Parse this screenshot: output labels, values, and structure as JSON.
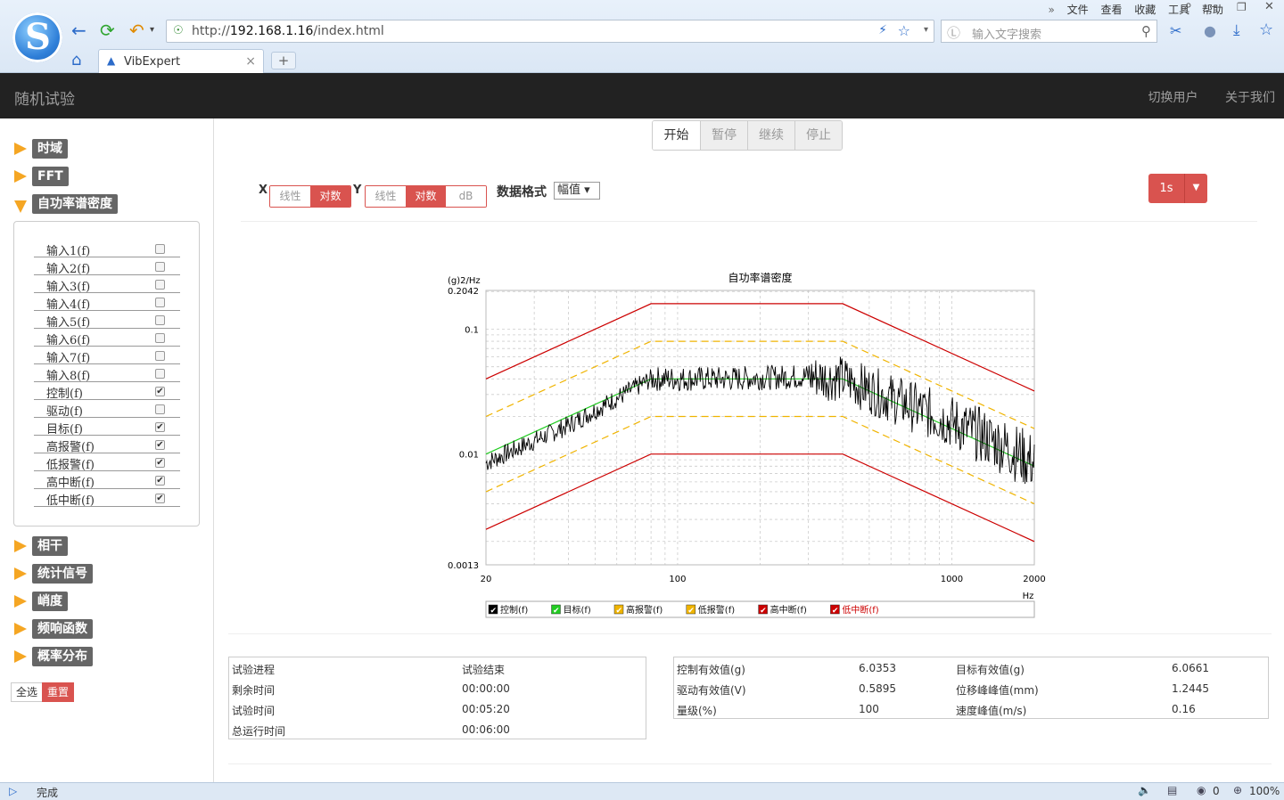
{
  "browser": {
    "url_prefix": "http://",
    "url_host": "192.168.1.16",
    "url_path": "/index.html",
    "search_placeholder": "输入文字搜索",
    "menus": [
      "文件",
      "查看",
      "收藏",
      "工具",
      "帮助"
    ],
    "tab_title": "VibExpert",
    "status_text": "完成",
    "status_count": "0",
    "zoom": "100%"
  },
  "app": {
    "title": "随机试验",
    "switch_user": "切换用户",
    "about": "关于我们"
  },
  "sidebar": {
    "sections_top": [
      "时域",
      "FFT",
      "自功率谱密度"
    ],
    "sections_bottom": [
      "相干",
      "统计信号",
      "峭度",
      "频响函数",
      "概率分布"
    ],
    "channels": [
      {
        "label": "输入1(f)",
        "checked": false
      },
      {
        "label": "输入2(f)",
        "checked": false
      },
      {
        "label": "输入3(f)",
        "checked": false
      },
      {
        "label": "输入4(f)",
        "checked": false
      },
      {
        "label": "输入5(f)",
        "checked": false
      },
      {
        "label": "输入6(f)",
        "checked": false
      },
      {
        "label": "输入7(f)",
        "checked": false
      },
      {
        "label": "输入8(f)",
        "checked": false
      },
      {
        "label": "控制(f)",
        "checked": true
      },
      {
        "label": "驱动(f)",
        "checked": false
      },
      {
        "label": "目标(f)",
        "checked": true
      },
      {
        "label": "高报警(f)",
        "checked": true
      },
      {
        "label": "低报警(f)",
        "checked": true
      },
      {
        "label": "高中断(f)",
        "checked": true
      },
      {
        "label": "低中断(f)",
        "checked": true
      }
    ],
    "select_all": "全选",
    "reset": "重置"
  },
  "controls": {
    "run_buttons": [
      "开始",
      "暂停",
      "继续",
      "停止"
    ],
    "x_label": "X",
    "y_label": "Y",
    "linear": "线性",
    "log": "对数",
    "db": "dB",
    "format_label": "数据格式",
    "format_value": "幅值 ▾",
    "interval": "1s"
  },
  "chart_data": {
    "type": "line",
    "title": "自功率谱密度",
    "ylabel": "(g)2/Hz",
    "xlabel": "Hz",
    "x_scale": "log",
    "y_scale": "log",
    "xlim": [
      20,
      2000
    ],
    "ylim": [
      0.0013,
      0.2042
    ],
    "x_ticks": [
      "20",
      "100",
      "1000",
      "2000"
    ],
    "y_ticks": [
      "0.2042",
      "0.1",
      "0.01",
      "0.0013"
    ],
    "grid": true,
    "legend_position": "bottom",
    "series": [
      {
        "name": "控制(f)",
        "color": "#000000",
        "points": [
          [
            20,
            0.0085
          ],
          [
            40,
            0.017
          ],
          [
            60,
            0.028
          ],
          [
            80,
            0.04
          ],
          [
            150,
            0.04
          ],
          [
            300,
            0.042
          ],
          [
            400,
            0.04
          ],
          [
            600,
            0.028
          ],
          [
            1000,
            0.018
          ],
          [
            1500,
            0.012
          ],
          [
            2000,
            0.0085
          ]
        ]
      },
      {
        "name": "目标(f)",
        "color": "#22cc22",
        "points": [
          [
            20,
            0.01
          ],
          [
            80,
            0.04
          ],
          [
            400,
            0.04
          ],
          [
            2000,
            0.008
          ]
        ]
      },
      {
        "name": "高报警(f)",
        "color": "#f0b400",
        "points": [
          [
            20,
            0.02
          ],
          [
            80,
            0.08
          ],
          [
            400,
            0.08
          ],
          [
            2000,
            0.016
          ]
        ]
      },
      {
        "name": "低报警(f)",
        "color": "#f0b400",
        "points": [
          [
            20,
            0.005
          ],
          [
            80,
            0.02
          ],
          [
            400,
            0.02
          ],
          [
            2000,
            0.004
          ]
        ]
      },
      {
        "name": "高中断(f)",
        "color": "#cc0000",
        "points": [
          [
            20,
            0.04
          ],
          [
            80,
            0.16
          ],
          [
            400,
            0.16
          ],
          [
            2000,
            0.032
          ]
        ]
      },
      {
        "name": "低中断(f)",
        "color": "#cc0000",
        "points": [
          [
            20,
            0.0025
          ],
          [
            80,
            0.01
          ],
          [
            400,
            0.01
          ],
          [
            2000,
            0.002
          ]
        ]
      }
    ]
  },
  "info_left": [
    [
      "试验进程",
      "试验结束"
    ],
    [
      "剩余时间",
      "00:00:00"
    ],
    [
      "试验时间",
      "00:05:20"
    ],
    [
      "总运行时间",
      "00:06:00"
    ]
  ],
  "info_right": [
    [
      "控制有效值(g)",
      "6.0353",
      "目标有效值(g)",
      "6.0661"
    ],
    [
      "驱动有效值(V)",
      "0.5895",
      "位移峰峰值(mm)",
      "1.2445"
    ],
    [
      "量级(%)",
      "100",
      "速度峰值(m/s)",
      "0.16"
    ]
  ]
}
